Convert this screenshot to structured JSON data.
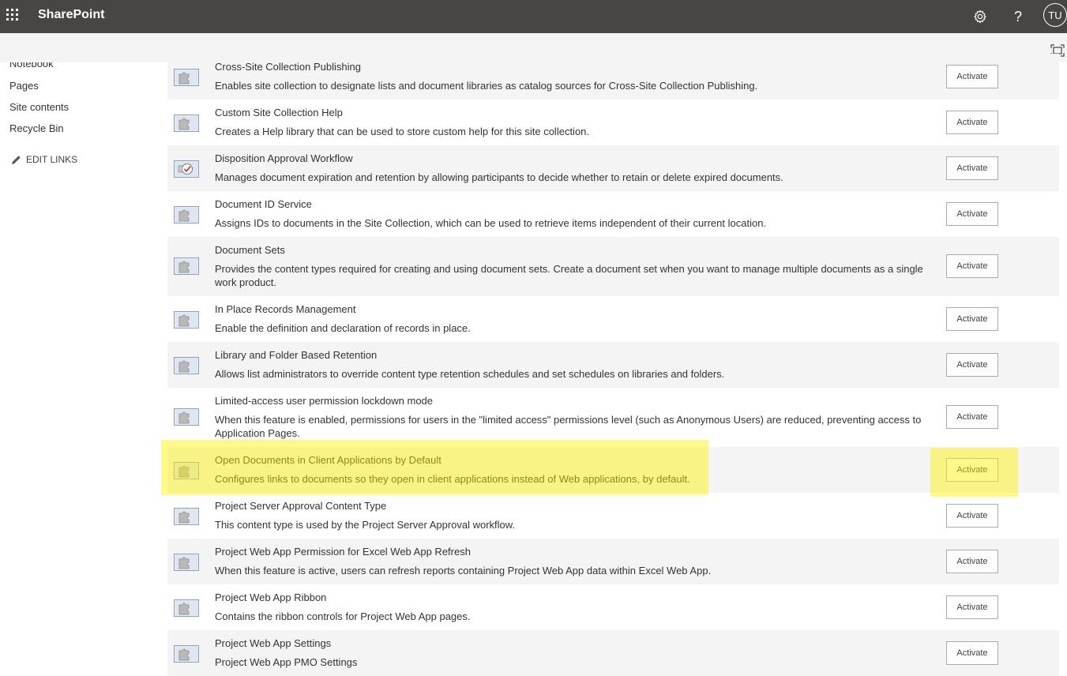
{
  "suite": {
    "app_name": "SharePoint",
    "settings_icon": "gear-icon",
    "help_label": "?",
    "avatar_initials": "TU"
  },
  "nav": {
    "items": [
      {
        "label": "Notebook"
      },
      {
        "label": "Pages"
      },
      {
        "label": "Site contents"
      },
      {
        "label": "Recycle Bin"
      }
    ],
    "edit_links": "EDIT LINKS"
  },
  "features": [
    {
      "title": "Cross-Site Collection Publishing",
      "description": "Enables site collection to designate lists and document libraries as catalog sources for Cross-Site Collection Publishing.",
      "button": "Activate",
      "icon": "feature-puzzle-icon"
    },
    {
      "title": "Custom Site Collection Help",
      "description": "Creates a Help library that can be used to store custom help for this site collection.",
      "button": "Activate",
      "icon": "feature-puzzle-icon"
    },
    {
      "title": "Disposition Approval Workflow",
      "description": "Manages document expiration and retention by allowing participants to decide whether to retain or delete expired documents.",
      "button": "Activate",
      "icon": "workflow-approval-icon"
    },
    {
      "title": "Document ID Service",
      "description": "Assigns IDs to documents in the Site Collection, which can be used to retrieve items independent of their current location.",
      "button": "Activate",
      "icon": "feature-puzzle-icon"
    },
    {
      "title": "Document Sets",
      "description": "Provides the content types required for creating and using document sets. Create a document set when you want to manage multiple documents as a single work product.",
      "button": "Activate",
      "icon": "feature-puzzle-icon"
    },
    {
      "title": "In Place Records Management",
      "description": "Enable the definition and declaration of records in place.",
      "button": "Activate",
      "icon": "feature-puzzle-icon"
    },
    {
      "title": "Library and Folder Based Retention",
      "description": "Allows list administrators to override content type retention schedules and set schedules on libraries and folders.",
      "button": "Activate",
      "icon": "feature-puzzle-icon"
    },
    {
      "title": "Limited-access user permission lockdown mode",
      "description": "When this feature is enabled, permissions for users in the \"limited access\" permissions level (such as Anonymous Users) are reduced, preventing access to Application Pages.",
      "button": "Activate",
      "icon": "feature-puzzle-icon"
    },
    {
      "title": "Open Documents in Client Applications by Default",
      "description": "Configures links to documents so they open in client applications instead of Web applications, by default.",
      "button": "Activate",
      "icon": "feature-puzzle-icon",
      "highlighted": true
    },
    {
      "title": "Project Server Approval Content Type",
      "description": "This content type is used by the Project Server Approval workflow.",
      "button": "Activate",
      "icon": "feature-puzzle-icon"
    },
    {
      "title": "Project Web App Permission for Excel Web App Refresh",
      "description": "When this feature is active, users can refresh reports containing Project Web App data within Excel Web App.",
      "button": "Activate",
      "icon": "feature-puzzle-icon"
    },
    {
      "title": "Project Web App Ribbon",
      "description": "Contains the ribbon controls for Project Web App pages.",
      "button": "Activate",
      "icon": "feature-puzzle-icon"
    },
    {
      "title": "Project Web App Settings",
      "description": "Project Web App PMO Settings",
      "button": "Activate",
      "icon": "feature-puzzle-icon"
    }
  ],
  "colors": {
    "suite_bar": "#484644",
    "row_alt": "#f4f4f4",
    "highlight": "#fff200"
  }
}
